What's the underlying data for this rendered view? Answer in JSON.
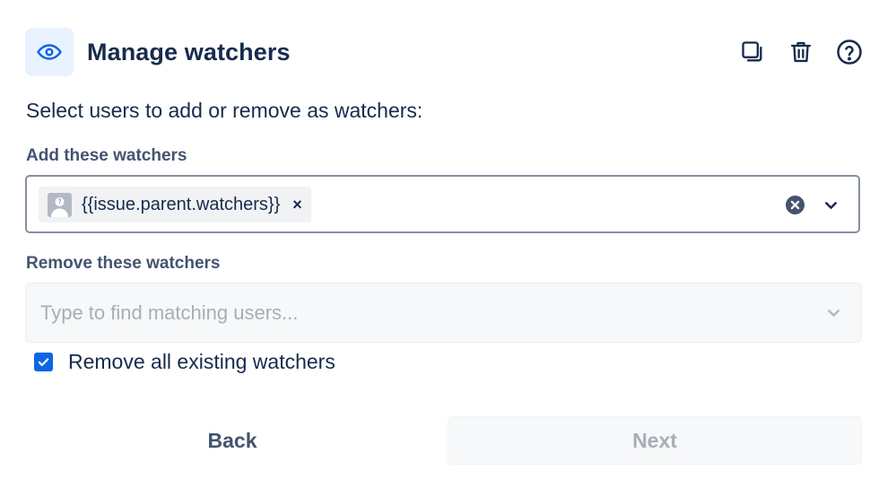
{
  "header": {
    "title": "Manage watchers",
    "icon": "eye-icon",
    "actions": [
      "copy-icon",
      "trash-icon",
      "help-icon"
    ]
  },
  "intro_text": "Select users to add or remove as watchers:",
  "add_field": {
    "label": "Add these watchers",
    "chips": [
      {
        "text": "{{issue.parent.watchers}}",
        "remove_glyph": "×"
      }
    ]
  },
  "remove_field": {
    "label": "Remove these watchers",
    "placeholder": "Type to find matching users..."
  },
  "remove_all": {
    "label": "Remove all existing watchers",
    "checked": true
  },
  "buttons": {
    "back": "Back",
    "next": "Next"
  },
  "colors": {
    "accent": "#0c66e4",
    "icon_bg": "#e9f2ff",
    "text": "#172b4d",
    "subtle_text": "#44546f",
    "disabled_text": "#a8adb7"
  }
}
